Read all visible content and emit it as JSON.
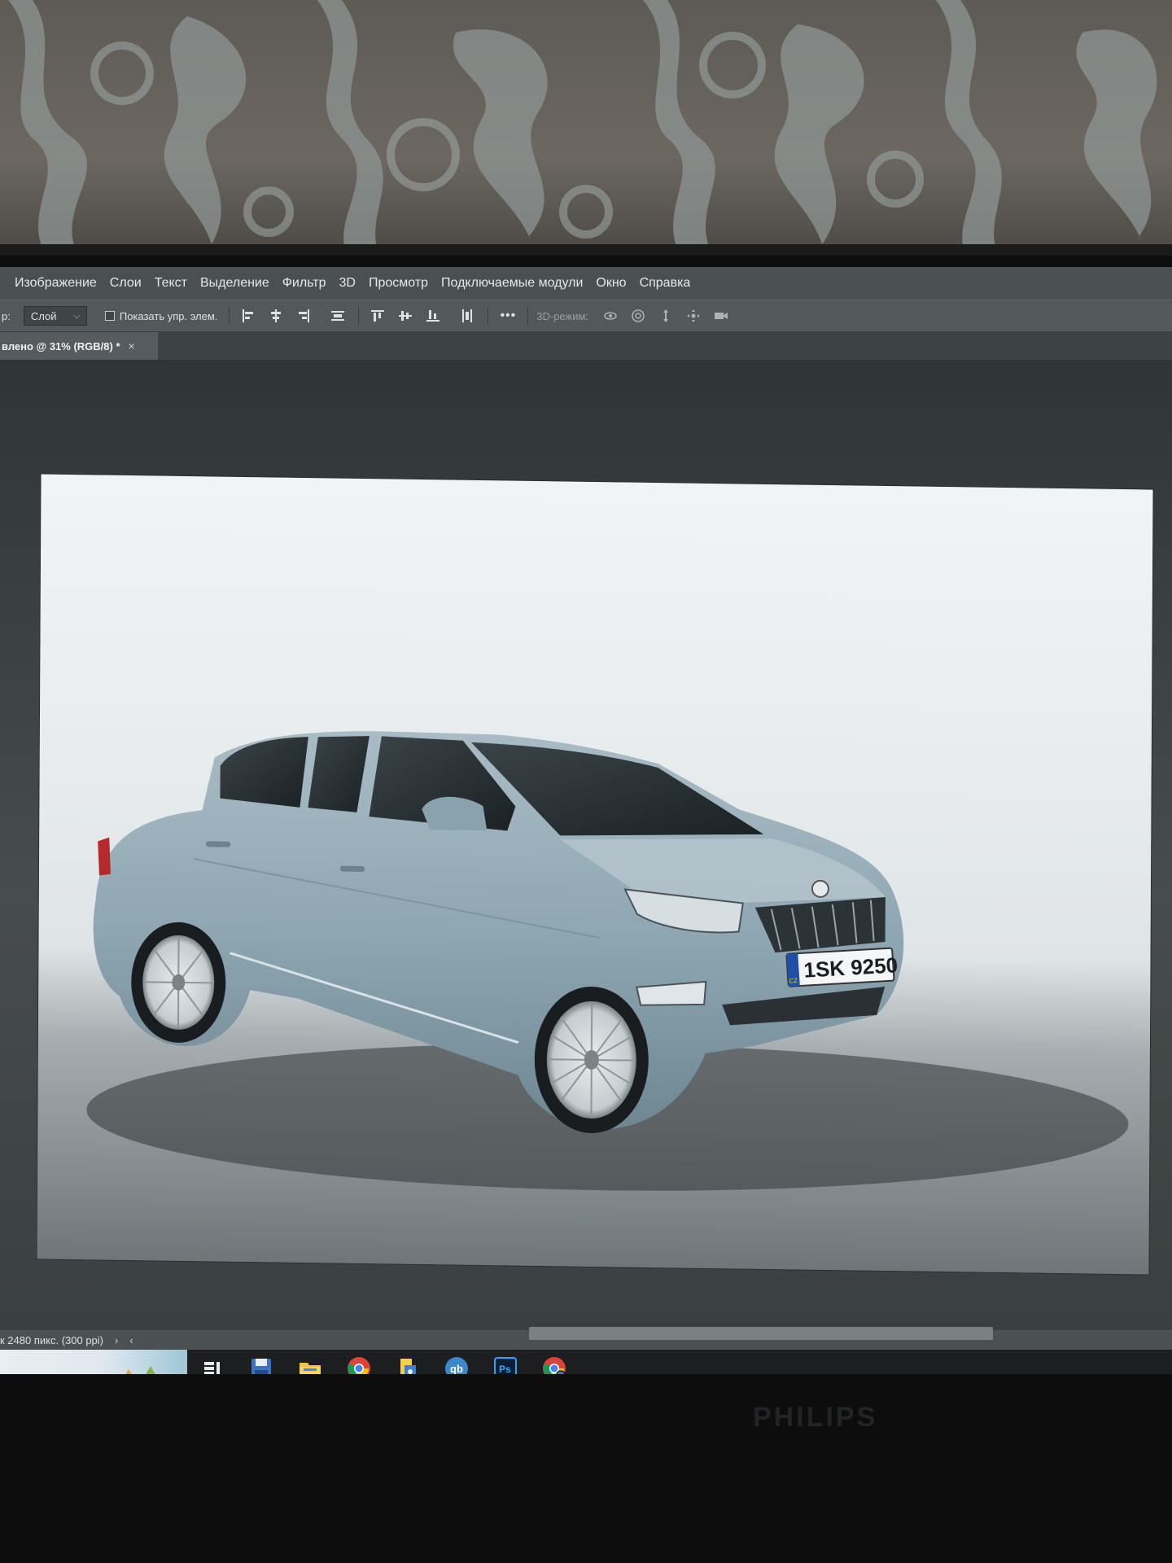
{
  "menubar": {
    "items": [
      "Изображение",
      "Слои",
      "Текст",
      "Выделение",
      "Фильтр",
      "3D",
      "Просмотр",
      "Подключаемые модули",
      "Окно",
      "Справка"
    ]
  },
  "options": {
    "tool_label": "р:",
    "layer_select": "Слой",
    "show_controls_label": "Показать упр. элем.",
    "mode_3d_label": "3D-режим:",
    "more_glyph": "•••"
  },
  "document": {
    "tab_title": "влено @ 31% (RGB/8) *",
    "close_glyph": "×"
  },
  "statusbar": {
    "info": "к 2480 пикс. (300 ppi)",
    "next_glyph": "›",
    "prev_glyph": "‹"
  },
  "canvas_image": {
    "license_plate": "1SK 9250",
    "plate_country": "CZ"
  },
  "taskbar": {
    "apps": [
      "task-view",
      "save",
      "file-explorer",
      "chrome",
      "file-manager",
      "qbittorrent",
      "photoshop",
      "chrome-profile"
    ],
    "qbittorrent_label": "qb",
    "photoshop_label": "Ps"
  },
  "bezel": {
    "brand": "PHILIPS"
  },
  "colors": {
    "menubar": "#4a4f52",
    "workspace": "#3a3f40",
    "car_body": "#8fa8b4",
    "taskbar": "#1c1e20",
    "active_indicator": "#5fa9e6"
  }
}
